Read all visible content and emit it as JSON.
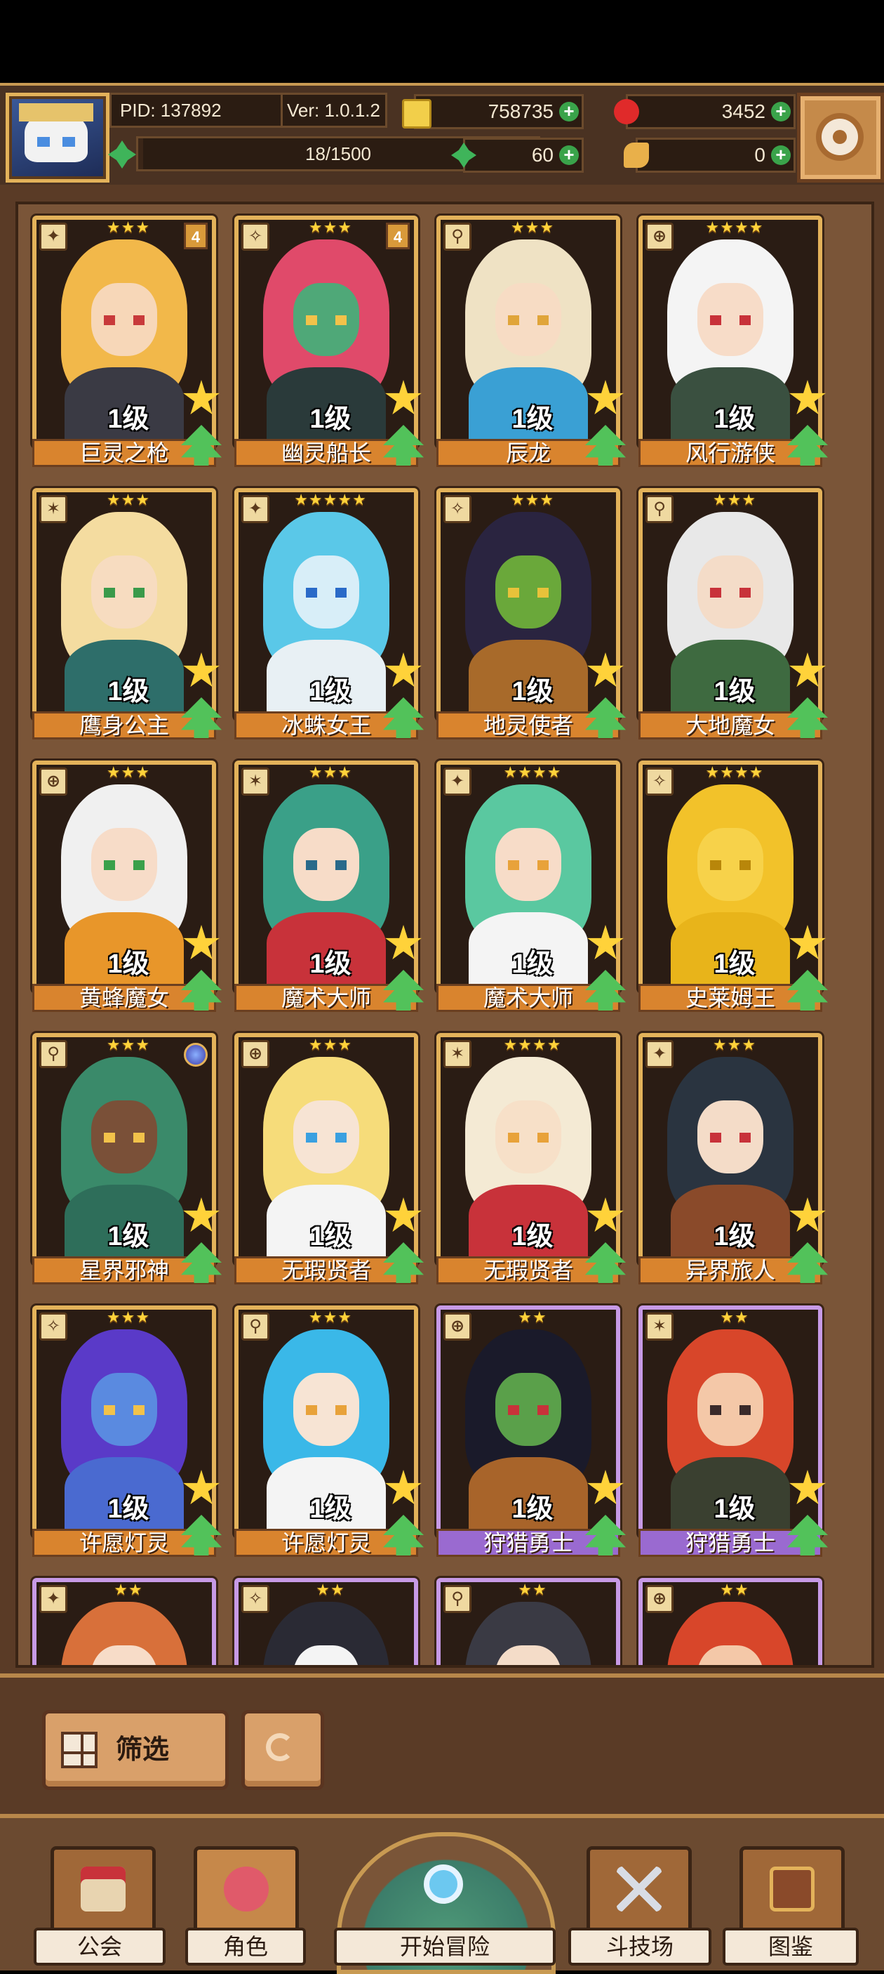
{
  "header": {
    "pid": "PID: 137892",
    "version": "Ver: 1.0.1.2",
    "stamina": "18/1500",
    "stamina_fraction": 0.012,
    "gold": "758735",
    "ruby": "3452",
    "clover": "60",
    "bread": "0",
    "icons": [
      "avatar",
      "coin-icon",
      "ruby-icon",
      "clover-icon",
      "bread-icon",
      "settings-gear-icon"
    ]
  },
  "cards": [
    {
      "name": "巨灵之枪",
      "level": "1级",
      "stars": "★★★",
      "badge": "4",
      "frame": "gold",
      "colors": {
        "hair": "#f2b84a",
        "face": "#f7d7b8",
        "eye": "#c83a3a",
        "body": "#3a3a44"
      }
    },
    {
      "name": "幽灵船长",
      "level": "1级",
      "stars": "★★★",
      "badge": "4",
      "frame": "gold",
      "colors": {
        "hair": "#e04a6a",
        "face": "#4fa878",
        "eye": "#f2c24a",
        "body": "#2a3a3a"
      }
    },
    {
      "name": "辰龙",
      "level": "1级",
      "stars": "★★★",
      "badge": "",
      "frame": "gold",
      "colors": {
        "hair": "#efe2c4",
        "face": "#f7dcc4",
        "eye": "#e0a53a",
        "body": "#3aa0d4"
      }
    },
    {
      "name": "风行游侠",
      "level": "1级",
      "stars": "★★★★",
      "badge": "",
      "frame": "gold",
      "colors": {
        "hair": "#f4f4f4",
        "face": "#f7dcc8",
        "eye": "#c8323a",
        "body": "#3a5040"
      }
    },
    {
      "name": "鹰身公主",
      "level": "1级",
      "stars": "★★★",
      "badge": "",
      "frame": "gold",
      "colors": {
        "hair": "#f4dca0",
        "face": "#f7dcc0",
        "eye": "#3a9a4a",
        "body": "#2e6e6a"
      }
    },
    {
      "name": "冰蛛女王",
      "level": "1级",
      "stars": "★★★★★",
      "badge": "",
      "frame": "gold",
      "colors": {
        "hair": "#5ac8e8",
        "face": "#d8eef8",
        "eye": "#2a6ac8",
        "body": "#e8f0f4"
      }
    },
    {
      "name": "地灵使者",
      "level": "1级",
      "stars": "★★★",
      "badge": "",
      "frame": "gold",
      "colors": {
        "hair": "#2a2440",
        "face": "#6aa83a",
        "eye": "#e8c23a",
        "body": "#a86a2a"
      }
    },
    {
      "name": "大地魔女",
      "level": "1级",
      "stars": "★★★",
      "badge": "",
      "frame": "gold",
      "colors": {
        "hair": "#e8e8e8",
        "face": "#f4dcc8",
        "eye": "#c8323a",
        "body": "#3e6a40"
      }
    },
    {
      "name": "黄蜂魔女",
      "level": "1级",
      "stars": "★★★",
      "badge": "",
      "frame": "gold",
      "colors": {
        "hair": "#f0f0f0",
        "face": "#f7dcc8",
        "eye": "#3aa04a",
        "body": "#e8962a"
      }
    },
    {
      "name": "魔术大师",
      "level": "1级",
      "stars": "★★★",
      "badge": "",
      "frame": "gold",
      "colors": {
        "hair": "#3aa088",
        "face": "#f7dcc8",
        "eye": "#2a6a8a",
        "body": "#c8323a"
      }
    },
    {
      "name": "魔术大师",
      "level": "1级",
      "stars": "★★★★",
      "badge": "",
      "frame": "gold",
      "colors": {
        "hair": "#5ac8a0",
        "face": "#f7dcc8",
        "eye": "#e8a23a",
        "body": "#f4f4f4"
      }
    },
    {
      "name": "史莱姆王",
      "level": "1级",
      "stars": "★★★★",
      "badge": "",
      "frame": "gold",
      "colors": {
        "hair": "#f2c22a",
        "face": "#f7d24a",
        "eye": "#b8860a",
        "body": "#e8b41a"
      }
    },
    {
      "name": "星界邪神",
      "level": "1级",
      "stars": "★★★",
      "badge": "",
      "orb": true,
      "frame": "gold",
      "colors": {
        "hair": "#3a8a6a",
        "face": "#7a5038",
        "eye": "#f2c24a",
        "body": "#2e6e5a"
      }
    },
    {
      "name": "无瑕贤者",
      "level": "1级",
      "stars": "★★★",
      "badge": "",
      "frame": "gold",
      "colors": {
        "hair": "#f6dc7a",
        "face": "#f7e4d4",
        "eye": "#3aa0e0",
        "body": "#f4f4f4"
      }
    },
    {
      "name": "无瑕贤者",
      "level": "1级",
      "stars": "★★★★",
      "badge": "",
      "frame": "gold",
      "colors": {
        "hair": "#f4ead4",
        "face": "#f7e0c8",
        "eye": "#e8a23a",
        "body": "#c8323a"
      }
    },
    {
      "name": "异界旅人",
      "level": "1级",
      "stars": "★★★",
      "badge": "",
      "frame": "gold",
      "colors": {
        "hair": "#2a3440",
        "face": "#f4dcc8",
        "eye": "#c8323a",
        "body": "#8a4a2a"
      }
    },
    {
      "name": "许愿灯灵",
      "level": "1级",
      "stars": "★★★",
      "badge": "",
      "frame": "gold",
      "colors": {
        "hair": "#5a3ac8",
        "face": "#5a8ae0",
        "eye": "#f2c24a",
        "body": "#4a6ad0"
      }
    },
    {
      "name": "许愿灯灵",
      "level": "1级",
      "stars": "★★★",
      "badge": "",
      "frame": "gold",
      "colors": {
        "hair": "#3ab8e8",
        "face": "#f7e4d4",
        "eye": "#e8a23a",
        "body": "#f4f4f4"
      }
    },
    {
      "name": "狩猎勇士",
      "level": "1级",
      "stars": "★★",
      "badge": "",
      "frame": "purple",
      "colors": {
        "hair": "#1a1a2a",
        "face": "#5aa04a",
        "eye": "#c8323a",
        "body": "#a8642a"
      }
    },
    {
      "name": "狩猎勇士",
      "level": "1级",
      "stars": "★★",
      "badge": "",
      "frame": "purple",
      "colors": {
        "hair": "#d8462a",
        "face": "#f4c8a8",
        "eye": "#3a2a2a",
        "body": "#3a4030"
      }
    },
    {
      "name": "",
      "level": "",
      "stars": "★★",
      "badge": "",
      "frame": "purple",
      "colors": {
        "hair": "#d8703a",
        "face": "#f7dcc8",
        "eye": "#c8323a",
        "body": "#6a4a2a"
      }
    },
    {
      "name": "",
      "level": "",
      "stars": "★★",
      "badge": "",
      "frame": "purple",
      "colors": {
        "hair": "#2a2a34",
        "face": "#f4f4f4",
        "eye": "#c8323a",
        "body": "#3a3a44"
      }
    },
    {
      "name": "",
      "level": "",
      "stars": "★★",
      "badge": "",
      "frame": "purple",
      "colors": {
        "hair": "#3a3a44",
        "face": "#f4dcc8",
        "eye": "#3aa04a",
        "body": "#3a3a44"
      }
    },
    {
      "name": "",
      "level": "",
      "stars": "★★",
      "badge": "",
      "frame": "purple",
      "colors": {
        "hair": "#d8462a",
        "face": "#f4c8a8",
        "eye": "#3a2a2a",
        "body": "#3a3a34"
      }
    }
  ],
  "toolbar": {
    "filter_label": "筛选",
    "icons": [
      "filter-grid-icon",
      "refresh-icon"
    ]
  },
  "nav": {
    "guild": "公会",
    "characters": "角色",
    "adventure": "开始冒险",
    "arena": "斗技场",
    "codex": "图鉴"
  }
}
